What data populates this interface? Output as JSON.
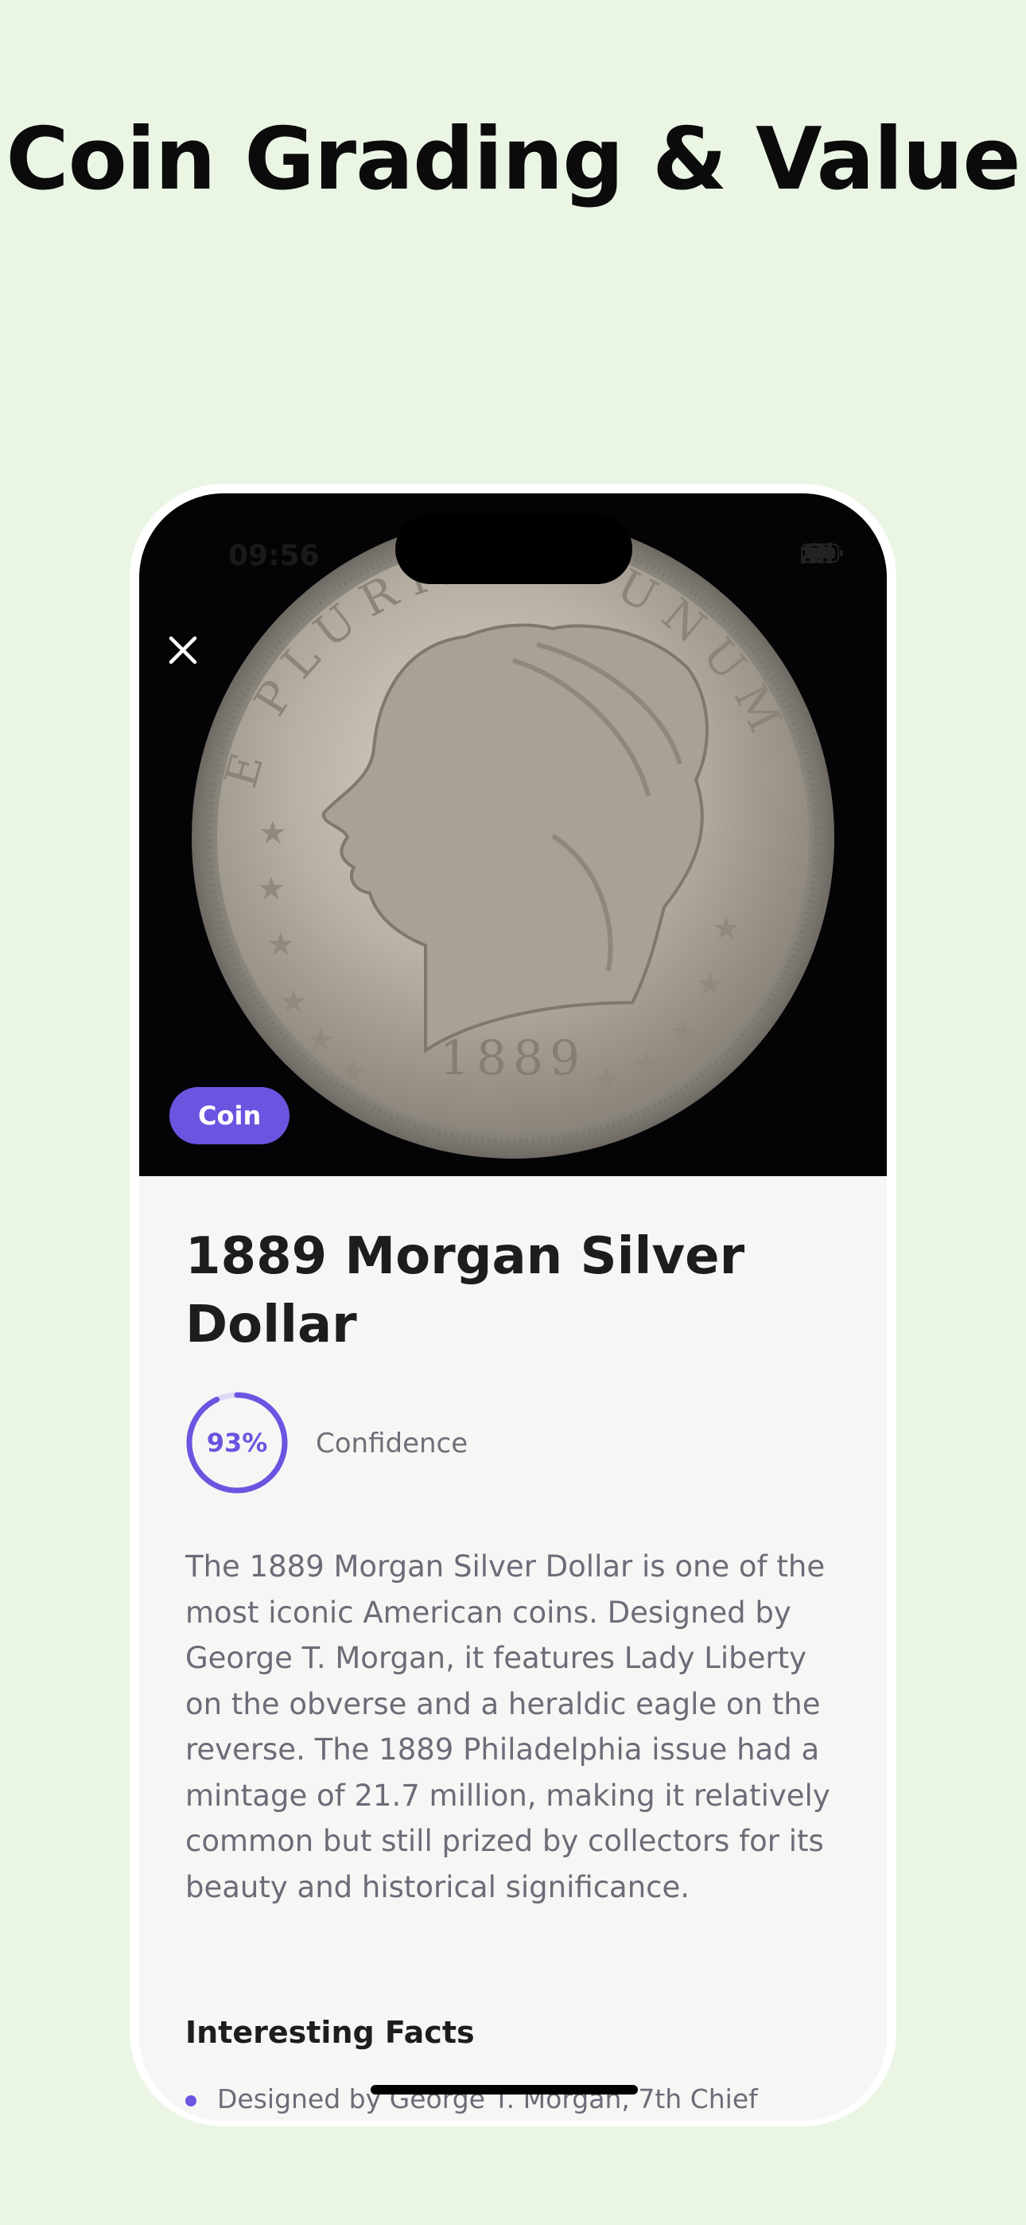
{
  "headline": "Coin Grading & Value",
  "status_bar": {
    "time": "09:56"
  },
  "item": {
    "category_badge": "Coin",
    "title": "1889 Morgan Silver Dollar",
    "confidence_percent": "93%",
    "confidence_value": 0.93,
    "confidence_label": "Confidence",
    "description": "The 1889 Morgan Silver Dollar is one of the most iconic American coins. Designed by George T. Morgan, it features Lady Liberty on the obverse and a heraldic eagle on the reverse. The 1889 Philadelphia issue had a mintage of 21.7 million, making it relatively common but still prized by collectors for its beauty and historical significance.",
    "facts_heading": "Interesting Facts",
    "facts": [
      "Designed by George T. Morgan, 7th Chief"
    ]
  },
  "coin_image": {
    "inscription": "E PLURIBUS UNUM",
    "year": "1889"
  },
  "icons": {
    "close": "close-icon",
    "signal": "signal-icon",
    "wifi": "wifi-icon",
    "battery": "battery-icon"
  },
  "colors": {
    "accent": "#6a55e0",
    "page_bg": "#eaf5e4",
    "hero_bg": "#040407"
  }
}
